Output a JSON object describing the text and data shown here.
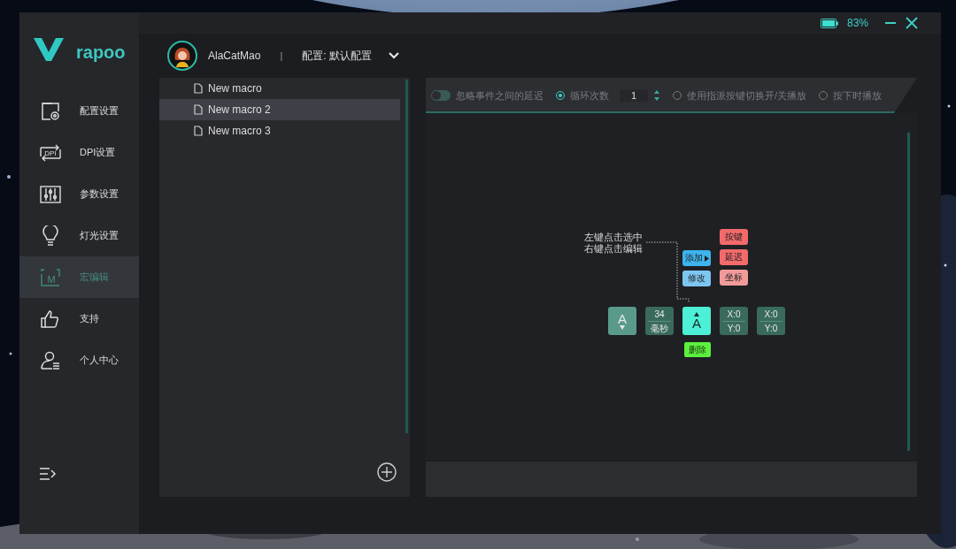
{
  "window": {
    "battery": "83%"
  },
  "logo": "rapoo",
  "user": {
    "name": "AlaCatMao",
    "separator": "|",
    "profile": "配置: 默认配置"
  },
  "sidebar": {
    "items": [
      {
        "label": "配置设置",
        "selected": false
      },
      {
        "label": "DPI设置",
        "icon_text": "DPI",
        "selected": false
      },
      {
        "label": "参数设置",
        "selected": false
      },
      {
        "label": "灯光设置",
        "selected": false
      },
      {
        "label": "宏编辑",
        "icon_text": "M",
        "selected": true
      },
      {
        "label": "支持",
        "selected": false
      },
      {
        "label": "个人中心",
        "selected": false
      }
    ]
  },
  "macros": {
    "items": [
      {
        "label": "New macro",
        "selected": false
      },
      {
        "label": "New macro 2",
        "selected": true
      },
      {
        "label": "New macro 3",
        "selected": false
      }
    ]
  },
  "options": [
    {
      "kind": "toggle",
      "label": "忽略事件之间的延迟",
      "on": false
    },
    {
      "kind": "radio",
      "label": "循环次数",
      "selected": true,
      "value": "1"
    },
    {
      "kind": "radio",
      "label": "使用指派按键切换开/关播放",
      "selected": false
    },
    {
      "kind": "radio",
      "label": "按下时播放",
      "selected": false
    }
  ],
  "editor": {
    "hint": [
      "左键点击选中",
      "右键点击编辑"
    ],
    "actions": [
      {
        "label": "添加",
        "color": "#3cb4ee",
        "submenu": true
      },
      {
        "label": "修改",
        "color": "#7cc6f2",
        "submenu": false
      }
    ],
    "menu": [
      {
        "label": "按键",
        "color": "#f26a6a"
      },
      {
        "label": "延迟",
        "color": "#f26a6a"
      },
      {
        "label": "坐标",
        "color": "#f29a9a"
      }
    ],
    "events": [
      {
        "kind": "key",
        "label": "A",
        "released": true,
        "selected": false
      },
      {
        "kind": "delay",
        "value": "34",
        "unit": "毫秒",
        "selected": false
      },
      {
        "kind": "key",
        "label": "A",
        "released": false,
        "selected": true
      },
      {
        "kind": "coord",
        "x": "X:0",
        "y": "Y:0",
        "selected": false
      },
      {
        "kind": "coord",
        "x": "X:0",
        "y": "Y:0",
        "selected": false
      }
    ],
    "delete": "删除"
  }
}
